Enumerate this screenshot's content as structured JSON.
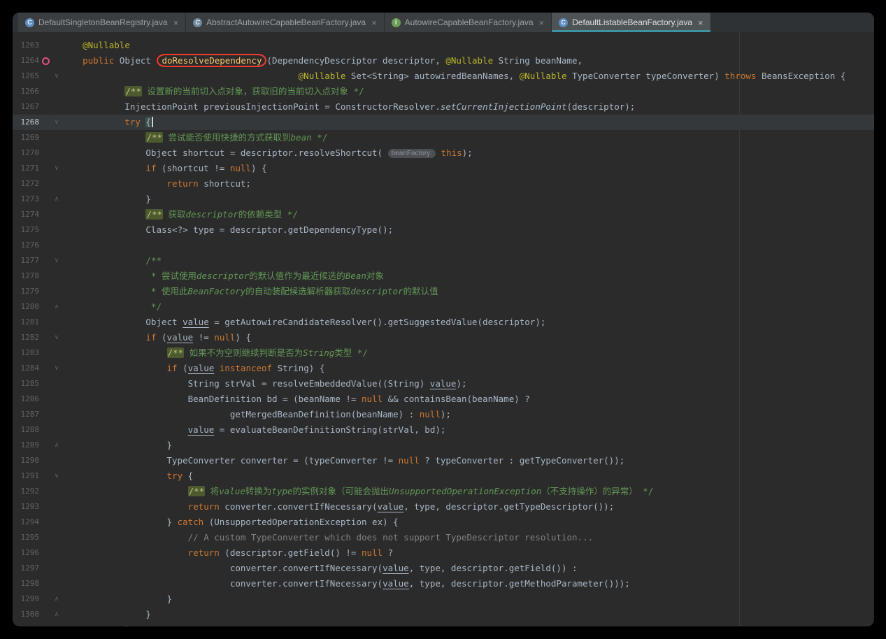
{
  "tabs": [
    {
      "label": "DefaultSingletonBeanRegistry.java",
      "icon": "C",
      "kind": "class",
      "active": false,
      "close_label": "×"
    },
    {
      "label": "AbstractAutowireCapableBeanFactory.java",
      "icon": "C",
      "kind": "abstract-class",
      "active": false,
      "close_label": "×"
    },
    {
      "label": "AutowireCapableBeanFactory.java",
      "icon": "I",
      "kind": "interface",
      "active": false,
      "close_label": "×"
    },
    {
      "label": "DefaultListableBeanFactory.java",
      "icon": "C",
      "kind": "class",
      "active": true,
      "close_label": "×"
    }
  ],
  "colors": {
    "editor_bg": "#2b2b2b",
    "keyword": "#cc7832",
    "annotation": "#bbb529",
    "method_declaration": "#ffc66b",
    "doc_comment": "#629755",
    "line_comment": "#808080",
    "default_text": "#a9b7c6",
    "line_number": "#606366",
    "active_tab_underline": "#3d93a1",
    "red_annotation_ring": "#f43b2a",
    "current_line_bg": "#35383a",
    "gutter_icon_pink": "#e0507d"
  },
  "editor": {
    "current_line": 1268,
    "annotation": {
      "shape": "red-ellipse",
      "around_text": "doResolveDependency"
    },
    "param_hint": "beanFactory:",
    "lines": [
      {
        "n": 1263,
        "s": [
          [
            "    ",
            ""
          ],
          [
            "@Nullable",
            "ann"
          ]
        ]
      },
      {
        "n": 1264,
        "icon": "recursive-call-gutter",
        "s": [
          [
            "    ",
            ""
          ],
          [
            "public",
            "k"
          ],
          [
            " Object ",
            "d"
          ],
          [
            "doResolveDependency",
            "mdecl ring"
          ],
          [
            "(DependencyDescriptor descriptor, ",
            "d"
          ],
          [
            "@Nullable",
            "ann"
          ],
          [
            " String beanName,",
            "d"
          ]
        ]
      },
      {
        "n": 1265,
        "fold": "start",
        "s": [
          [
            "                                             ",
            ""
          ],
          [
            "@Nullable",
            "ann"
          ],
          [
            " Set<String> autowiredBeanNames, ",
            "d"
          ],
          [
            "@Nullable",
            "ann"
          ],
          [
            " TypeConverter typeConverter) ",
            "d"
          ],
          [
            "throws",
            "k"
          ],
          [
            " BeansException {",
            "d"
          ]
        ]
      },
      {
        "n": 1266,
        "s": [
          [
            "            ",
            ""
          ],
          [
            "/**",
            "cmark"
          ],
          [
            " 设置新的当前切入点对象，获取旧的当前切入点对象 ",
            "cdoc"
          ],
          [
            "*/",
            "cdoc"
          ]
        ]
      },
      {
        "n": 1267,
        "s": [
          [
            "            InjectionPoint previousInjectionPoint = ConstructorResolver.",
            "d"
          ],
          [
            "setCurrentInjectionPoint",
            "si"
          ],
          [
            "(descriptor);",
            "d"
          ]
        ]
      },
      {
        "n": 1268,
        "fold": "start",
        "s": [
          [
            "            ",
            ""
          ],
          [
            "try",
            "k"
          ],
          [
            " ",
            "d"
          ],
          [
            "{",
            "brace"
          ],
          [
            "",
            "caret"
          ]
        ]
      },
      {
        "n": 1269,
        "s": [
          [
            "                ",
            ""
          ],
          [
            "/**",
            "cmark"
          ],
          [
            " 尝试能否使用快捷的方式获取到",
            "cdoc"
          ],
          [
            "bean",
            "cdoci"
          ],
          [
            " ",
            "cdoc"
          ],
          [
            "*/",
            "cdoc"
          ]
        ]
      },
      {
        "n": 1270,
        "s": [
          [
            "                Object shortcut = descriptor.resolveShortcut( ",
            "d"
          ],
          [
            "beanFactory:",
            "hint"
          ],
          [
            " ",
            "d"
          ],
          [
            "this",
            "k"
          ],
          [
            ");",
            "d"
          ]
        ]
      },
      {
        "n": 1271,
        "fold": "start",
        "s": [
          [
            "                ",
            ""
          ],
          [
            "if",
            "k"
          ],
          [
            " (shortcut != ",
            "d"
          ],
          [
            "null",
            "k"
          ],
          [
            ") {",
            "d"
          ]
        ]
      },
      {
        "n": 1272,
        "s": [
          [
            "                    ",
            ""
          ],
          [
            "return",
            "k"
          ],
          [
            " shortcut;",
            "d"
          ]
        ]
      },
      {
        "n": 1273,
        "fold": "end",
        "s": [
          [
            "                }",
            "d"
          ]
        ]
      },
      {
        "n": 1274,
        "s": [
          [
            "                ",
            ""
          ],
          [
            "/**",
            "cmark"
          ],
          [
            " 获取",
            "cdoc"
          ],
          [
            "descriptor",
            "cdoci"
          ],
          [
            "的依赖类型 ",
            "cdoc"
          ],
          [
            "*/",
            "cdoc"
          ]
        ]
      },
      {
        "n": 1275,
        "s": [
          [
            "                Class<?> type = descriptor.getDependencyType();",
            "d"
          ]
        ]
      },
      {
        "n": 1276,
        "s": []
      },
      {
        "n": 1277,
        "fold": "start",
        "s": [
          [
            "                ",
            ""
          ],
          [
            "/**",
            "cdoc"
          ]
        ]
      },
      {
        "n": 1278,
        "s": [
          [
            "                 * 尝试使用",
            "cdoc"
          ],
          [
            "descriptor",
            "cdoci"
          ],
          [
            "的默认值作为最近候选的",
            "cdoc"
          ],
          [
            "Bean",
            "cdoci"
          ],
          [
            "对象",
            "cdoc"
          ]
        ]
      },
      {
        "n": 1279,
        "s": [
          [
            "                 * 使用此",
            "cdoc"
          ],
          [
            "BeanFactory",
            "cdoci"
          ],
          [
            "的自动装配候选解析器获取",
            "cdoc"
          ],
          [
            "descriptor",
            "cdoci"
          ],
          [
            "的默认值",
            "cdoc"
          ]
        ]
      },
      {
        "n": 1280,
        "fold": "end",
        "s": [
          [
            "                 */",
            "cdoc"
          ]
        ]
      },
      {
        "n": 1281,
        "s": [
          [
            "                Object ",
            "d"
          ],
          [
            "value",
            "u"
          ],
          [
            " = getAutowireCandidateResolver().getSuggestedValue(descriptor);",
            "d"
          ]
        ]
      },
      {
        "n": 1282,
        "fold": "start",
        "s": [
          [
            "                ",
            ""
          ],
          [
            "if",
            "k"
          ],
          [
            " (",
            "d"
          ],
          [
            "value",
            "u"
          ],
          [
            " != ",
            "d"
          ],
          [
            "null",
            "k"
          ],
          [
            ") {",
            "d"
          ]
        ]
      },
      {
        "n": 1283,
        "s": [
          [
            "                    ",
            ""
          ],
          [
            "/**",
            "cmark"
          ],
          [
            " 如果不为空则继续判断是否为",
            "cdoc"
          ],
          [
            "String",
            "cdoci"
          ],
          [
            "类型 ",
            "cdoc"
          ],
          [
            "*/",
            "cdoc"
          ]
        ]
      },
      {
        "n": 1284,
        "fold": "start",
        "s": [
          [
            "                    ",
            ""
          ],
          [
            "if",
            "k"
          ],
          [
            " (",
            "d"
          ],
          [
            "value",
            "u"
          ],
          [
            " ",
            "d"
          ],
          [
            "instanceof",
            "k"
          ],
          [
            " String) {",
            "d"
          ]
        ]
      },
      {
        "n": 1285,
        "s": [
          [
            "                        String strVal = resolveEmbeddedValue((String) ",
            "d"
          ],
          [
            "value",
            "u"
          ],
          [
            ");",
            "d"
          ]
        ]
      },
      {
        "n": 1286,
        "s": [
          [
            "                        BeanDefinition bd = (beanName != ",
            "d"
          ],
          [
            "null",
            "k"
          ],
          [
            " && containsBean(beanName) ?",
            "d"
          ]
        ]
      },
      {
        "n": 1287,
        "s": [
          [
            "                                getMergedBeanDefinition(beanName) : ",
            "d"
          ],
          [
            "null",
            "k"
          ],
          [
            ");",
            "d"
          ]
        ]
      },
      {
        "n": 1288,
        "s": [
          [
            "                        ",
            "d"
          ],
          [
            "value",
            "u"
          ],
          [
            " = evaluateBeanDefinitionString(strVal, bd);",
            "d"
          ]
        ]
      },
      {
        "n": 1289,
        "fold": "end",
        "s": [
          [
            "                    }",
            "d"
          ]
        ]
      },
      {
        "n": 1290,
        "s": [
          [
            "                    TypeConverter converter = (typeConverter != ",
            "d"
          ],
          [
            "null",
            "k"
          ],
          [
            " ? typeConverter : getTypeConverter());",
            "d"
          ]
        ]
      },
      {
        "n": 1291,
        "fold": "start",
        "s": [
          [
            "                    ",
            ""
          ],
          [
            "try",
            "k"
          ],
          [
            " {",
            "d"
          ]
        ]
      },
      {
        "n": 1292,
        "s": [
          [
            "                        ",
            ""
          ],
          [
            "/**",
            "cmark"
          ],
          [
            " 将",
            "cdoc"
          ],
          [
            "value",
            "cdoci"
          ],
          [
            "转换为",
            "cdoc"
          ],
          [
            "type",
            "cdoci"
          ],
          [
            "的实例对象（可能会抛出",
            "cdoc"
          ],
          [
            "UnsupportedOperationException",
            "cdoci"
          ],
          [
            "（不支持操作）的异常） ",
            "cdoc"
          ],
          [
            "*/",
            "cdoc"
          ]
        ]
      },
      {
        "n": 1293,
        "s": [
          [
            "                        ",
            ""
          ],
          [
            "return",
            "k"
          ],
          [
            " converter.convertIfNecessary(",
            "d"
          ],
          [
            "value",
            "u"
          ],
          [
            ", type, descriptor.getTypeDescriptor());",
            "d"
          ]
        ]
      },
      {
        "n": 1294,
        "s": [
          [
            "                    } ",
            "d"
          ],
          [
            "catch",
            "k"
          ],
          [
            " (UnsupportedOperationException ex) {",
            "d"
          ]
        ]
      },
      {
        "n": 1295,
        "s": [
          [
            "                        ",
            ""
          ],
          [
            "// A custom TypeConverter which does not support TypeDescriptor resolution...",
            "clc"
          ]
        ]
      },
      {
        "n": 1296,
        "s": [
          [
            "                        ",
            ""
          ],
          [
            "return",
            "k"
          ],
          [
            " (descriptor.getField() != ",
            "d"
          ],
          [
            "null",
            "k"
          ],
          [
            " ?",
            "d"
          ]
        ]
      },
      {
        "n": 1297,
        "s": [
          [
            "                                converter.convertIfNecessary(",
            "d"
          ],
          [
            "value",
            "u"
          ],
          [
            ", type, descriptor.getField()) :",
            "d"
          ]
        ]
      },
      {
        "n": 1298,
        "s": [
          [
            "                                converter.convertIfNecessary(",
            "d"
          ],
          [
            "value",
            "u"
          ],
          [
            ", type, descriptor.getMethodParameter()));",
            "d"
          ]
        ]
      },
      {
        "n": 1299,
        "fold": "end",
        "s": [
          [
            "                    }",
            "d"
          ]
        ]
      },
      {
        "n": 1300,
        "fold": "end",
        "s": [
          [
            "                }",
            "d"
          ]
        ]
      },
      {
        "n": 1301,
        "s": [
          [
            "            }",
            "d"
          ]
        ]
      }
    ]
  }
}
